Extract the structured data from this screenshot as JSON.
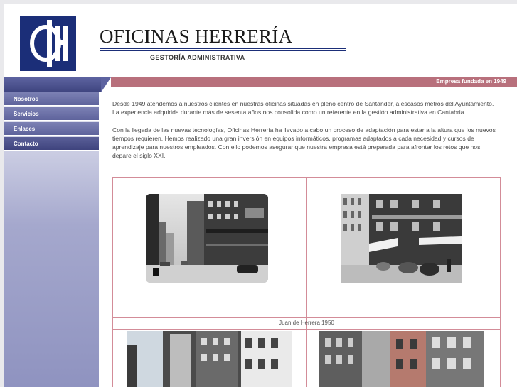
{
  "brand": {
    "name": "OFICINAS HERRERÍA",
    "tagline": "GESTORÍA ADMINISTRATIVA",
    "logo_icon": "oh-monogram-logo"
  },
  "banner": {
    "founded": "Empresa fundada en 1949"
  },
  "nav": {
    "items": [
      {
        "label": "Nosotros"
      },
      {
        "label": "Servicios"
      },
      {
        "label": "Enlaces"
      },
      {
        "label": "Contacto"
      }
    ]
  },
  "content": {
    "paragraph1": "Desde 1949 atendemos a nuestros clientes en nuestras oficinas situadas en pleno centro de Santander, a escasos metros del Ayuntamiento. La experiencia adquirida durante más de sesenta años nos consolida como un referente en la gestión administrativa en Cantabria.",
    "paragraph2": "Con la llegada de las nuevas tecnologías, Oficinas Herrería ha llevado a cabo un proceso de adaptación para estar a la altura que los nuevos tiempos requieren. Hemos realizado una gran inversión en equipos informáticos, programas adaptados a cada necesidad y cursos de aprendizaje para nuestros empleados. Con ello podemos asegurar que nuestra empresa está preparada para afrontar los retos que nos depare el siglo XXI."
  },
  "gallery": {
    "caption": "Juan de Herrera 1950"
  },
  "colors": {
    "logo_blue": "#1b2e78",
    "nav_purple": "#5e639c",
    "band_rose": "#b8707c",
    "gallery_border": "#d38c98"
  }
}
